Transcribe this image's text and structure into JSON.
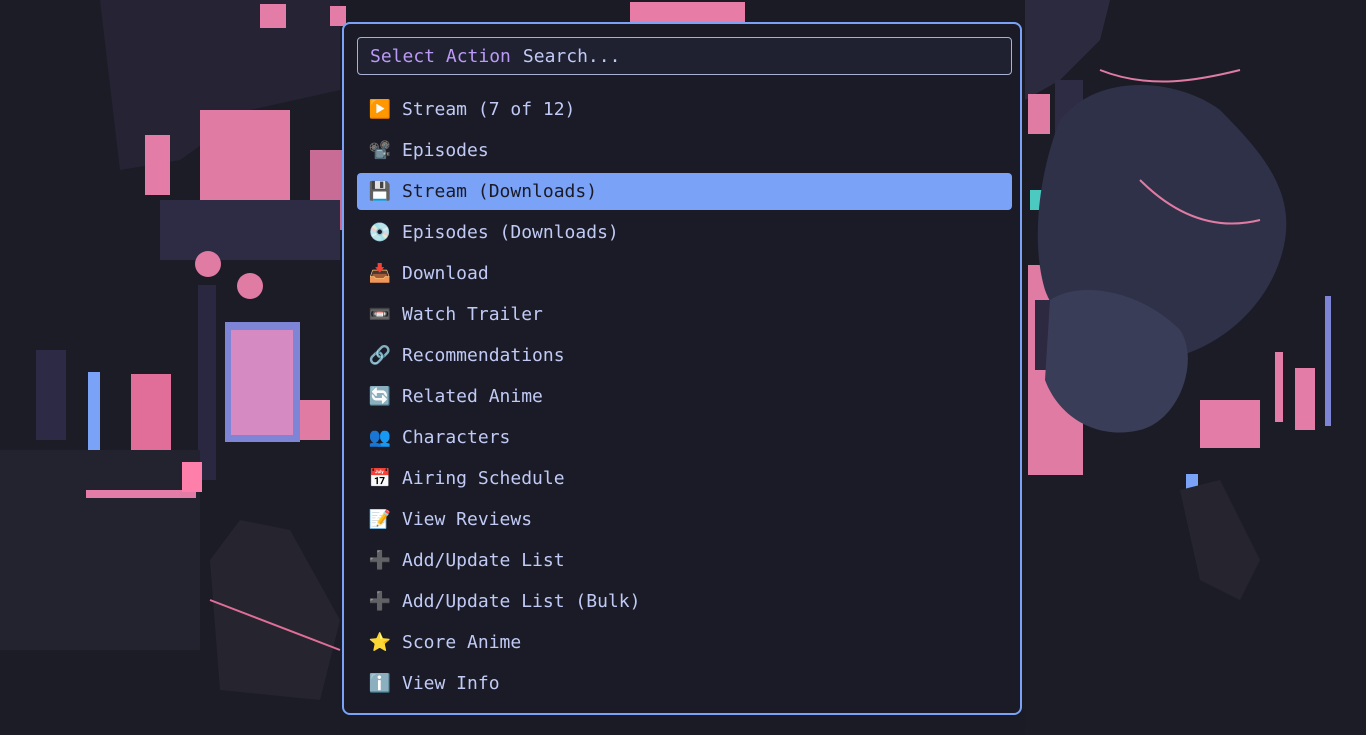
{
  "colors": {
    "background": "#1a1b26",
    "border": "#7aa2f7",
    "selected": "#7aa2f7",
    "text": "#c0caf5",
    "prompt": "#bb9af7"
  },
  "search": {
    "prompt": "Select Action",
    "placeholder": "Search..."
  },
  "items": [
    {
      "icon": "▶️",
      "icon_name": "play-button-icon",
      "label": "Stream (7 of 12)"
    },
    {
      "icon": "📽️",
      "icon_name": "film-projector-icon",
      "label": "Episodes"
    },
    {
      "icon": "💾",
      "icon_name": "floppy-disk-icon",
      "label": "Stream (Downloads)",
      "selected": true
    },
    {
      "icon": "💿",
      "icon_name": "optical-disc-icon",
      "label": "Episodes (Downloads)"
    },
    {
      "icon": "📥",
      "icon_name": "inbox-tray-icon",
      "label": "Download"
    },
    {
      "icon": "📼",
      "icon_name": "videocassette-icon",
      "label": "Watch Trailer"
    },
    {
      "icon": "🔗",
      "icon_name": "link-icon",
      "label": "Recommendations"
    },
    {
      "icon": "🔄",
      "icon_name": "refresh-arrows-icon",
      "label": "Related Anime"
    },
    {
      "icon": "👥",
      "icon_name": "people-icon",
      "label": "Characters"
    },
    {
      "icon": "📅",
      "icon_name": "calendar-icon",
      "label": "Airing Schedule"
    },
    {
      "icon": "📝",
      "icon_name": "memo-icon",
      "label": "View Reviews"
    },
    {
      "icon": "➕",
      "icon_name": "plus-icon",
      "label": "Add/Update List"
    },
    {
      "icon": "➕",
      "icon_name": "plus-icon",
      "label": "Add/Update List (Bulk)"
    },
    {
      "icon": "⭐",
      "icon_name": "star-icon",
      "label": "Score Anime"
    },
    {
      "icon": "ℹ️",
      "icon_name": "info-icon",
      "label": "View Info"
    }
  ]
}
